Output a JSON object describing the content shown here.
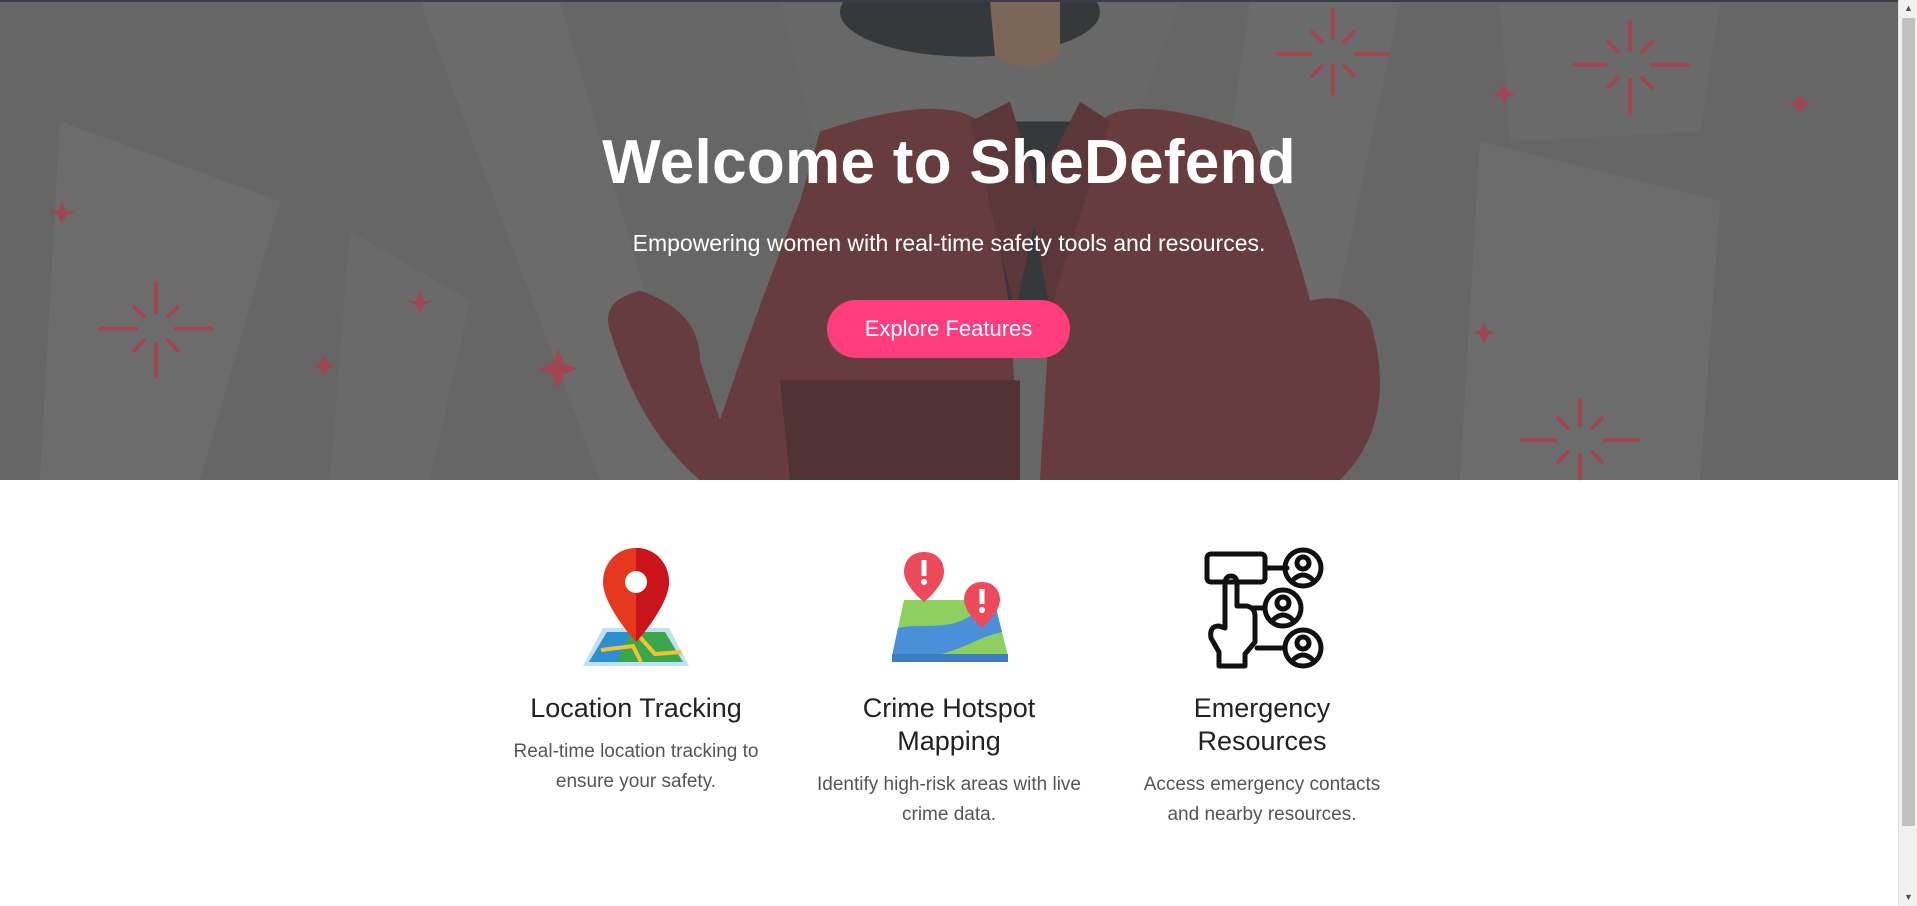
{
  "hero": {
    "title": "Welcome to SheDefend",
    "subtitle": "Empowering women with real-time safety tools and resources.",
    "cta_label": "Explore Features"
  },
  "features": [
    {
      "icon": "location-pin-map-icon",
      "title": "Location Tracking",
      "description": "Real-time location tracking to ensure your safety."
    },
    {
      "icon": "crime-hotspot-map-icon",
      "title": "Crime Hotspot Mapping",
      "description": "Identify high-risk areas with live crime data."
    },
    {
      "icon": "emergency-contacts-icon",
      "title": "Emergency Resources",
      "description": "Access emergency contacts and nearby resources."
    }
  ],
  "colors": {
    "accent": "#ff3d7f",
    "hero_overlay": "#6b6b6b",
    "jacket": "#7a2a30",
    "sparkle": "#c4394a"
  }
}
